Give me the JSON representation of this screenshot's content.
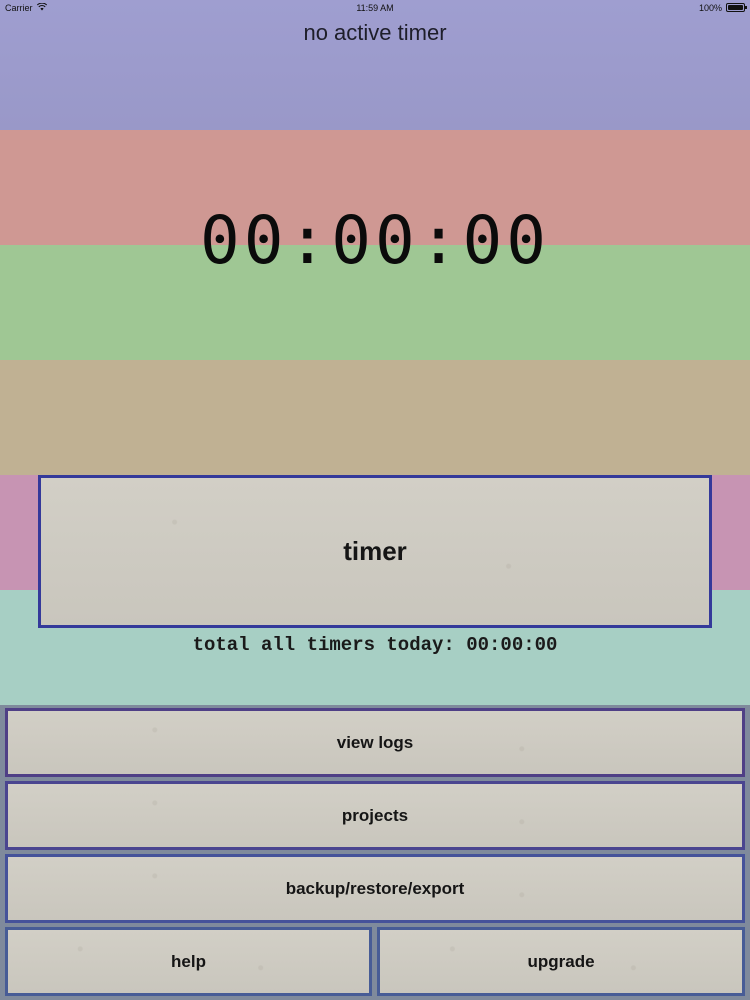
{
  "status_bar": {
    "carrier": "Carrier",
    "time": "11:59 AM",
    "battery": "100%",
    "wifi_icon": "wifi-icon",
    "battery_icon": "battery-icon"
  },
  "header": {
    "title": "no active timer"
  },
  "clock": {
    "display": "00:00:00"
  },
  "timer_button": {
    "label": "timer"
  },
  "totals": {
    "text": "total all timers today: 00:00:00"
  },
  "menu": {
    "view_logs": "view logs",
    "projects": "projects",
    "backup": "backup/restore/export",
    "help": "help",
    "upgrade": "upgrade"
  },
  "colors": {
    "band_purple": "#9f9ed0",
    "band_red": "#cf9893",
    "band_green": "#9fc794",
    "band_tan": "#c0b193",
    "band_pink": "#c794b3",
    "band_teal": "#a7cfc4",
    "button_border": "#34399a",
    "paper": "#d2cfc6"
  }
}
